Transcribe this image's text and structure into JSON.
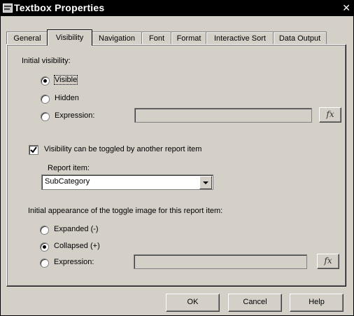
{
  "window": {
    "title": "Textbox Properties",
    "close_glyph": "✕"
  },
  "tabs": [
    {
      "label": "General"
    },
    {
      "label": "Visibility"
    },
    {
      "label": "Navigation"
    },
    {
      "label": "Font"
    },
    {
      "label": "Format"
    },
    {
      "label": "Interactive Sort"
    },
    {
      "label": "Data Output"
    }
  ],
  "active_tab": "Visibility",
  "visibility": {
    "section_label": "Initial visibility:",
    "options": [
      {
        "label": "Visible",
        "selected": true
      },
      {
        "label": "Hidden",
        "selected": false
      },
      {
        "label": "Expression:",
        "selected": false
      }
    ],
    "expression_value": "",
    "fx_label": "fx"
  },
  "toggle": {
    "checkbox_label": "Visibility can be toggled by another report item",
    "checked": true,
    "report_item_label": "Report item:",
    "report_item_value": "SubCategory"
  },
  "appearance": {
    "section_label": "Initial appearance of the toggle image for this report item:",
    "options": [
      {
        "label": "Expanded (-)",
        "selected": false
      },
      {
        "label": "Collapsed (+)",
        "selected": true
      },
      {
        "label": "Expression:",
        "selected": false
      }
    ],
    "expression_value": "",
    "fx_label": "fx"
  },
  "buttons": {
    "ok": "OK",
    "cancel": "Cancel",
    "help": "Help"
  },
  "icons": {
    "app": "textbox-icon",
    "close": "close-icon",
    "dropdown": "chevron-down-icon"
  }
}
